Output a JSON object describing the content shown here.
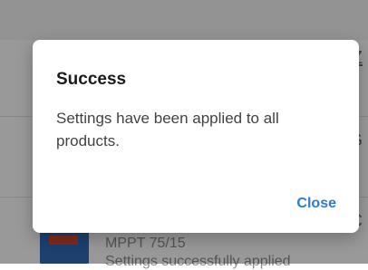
{
  "background": {
    "row_edges": [
      "Z",
      "G",
      "C"
    ],
    "device": {
      "name": "MPPT 75/15",
      "status": "Settings successfully applied"
    }
  },
  "dialog": {
    "title": "Success",
    "message": "Settings have been applied to all products.",
    "close_label": "Close"
  },
  "colors": {
    "accent": "#2d7bd0",
    "scrim": "rgba(0,0,0,0.40)"
  }
}
